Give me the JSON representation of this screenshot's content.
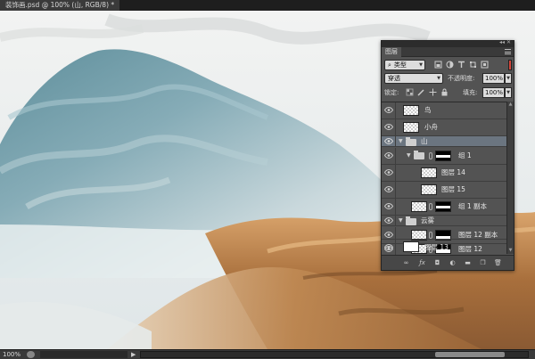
{
  "document": {
    "tab_title": "装饰画.psd @ 100% (山, RGB/8) *"
  },
  "status": {
    "zoom": "100%"
  },
  "panel": {
    "tab_label": "图层",
    "filter": {
      "label": "类型"
    },
    "blend_mode": "穿透",
    "opacity_label": "不透明度:",
    "opacity_value": "100%",
    "lock_label": "锁定:",
    "fill_label": "填充:",
    "fill_value": "100%",
    "layers": [
      {
        "name": "鸟",
        "type": "pixel",
        "selected": false
      },
      {
        "name": "小舟",
        "type": "pixel",
        "selected": false
      },
      {
        "name": "山",
        "type": "group",
        "selected": true
      },
      {
        "name": "组 1",
        "type": "group-mask",
        "selected": false
      },
      {
        "name": "图层 14",
        "type": "pixel-clipped",
        "selected": false
      },
      {
        "name": "图层 15",
        "type": "pixel-clipped",
        "selected": false
      },
      {
        "name": "组 1 副本",
        "type": "pixel-mask",
        "selected": false
      },
      {
        "name": "云雾",
        "type": "group",
        "selected": false
      },
      {
        "name": "图层 12 副本",
        "type": "pixel-mask",
        "selected": false
      },
      {
        "name": "图层 12",
        "type": "pixel-mask",
        "selected": false
      },
      {
        "name": "图层 13",
        "type": "pixel-white",
        "selected": false
      }
    ]
  },
  "colors": {
    "mountain": "#7da3b0",
    "earth": "#b07a45",
    "panel_bg": "#535353",
    "selection": "#6b7580"
  }
}
